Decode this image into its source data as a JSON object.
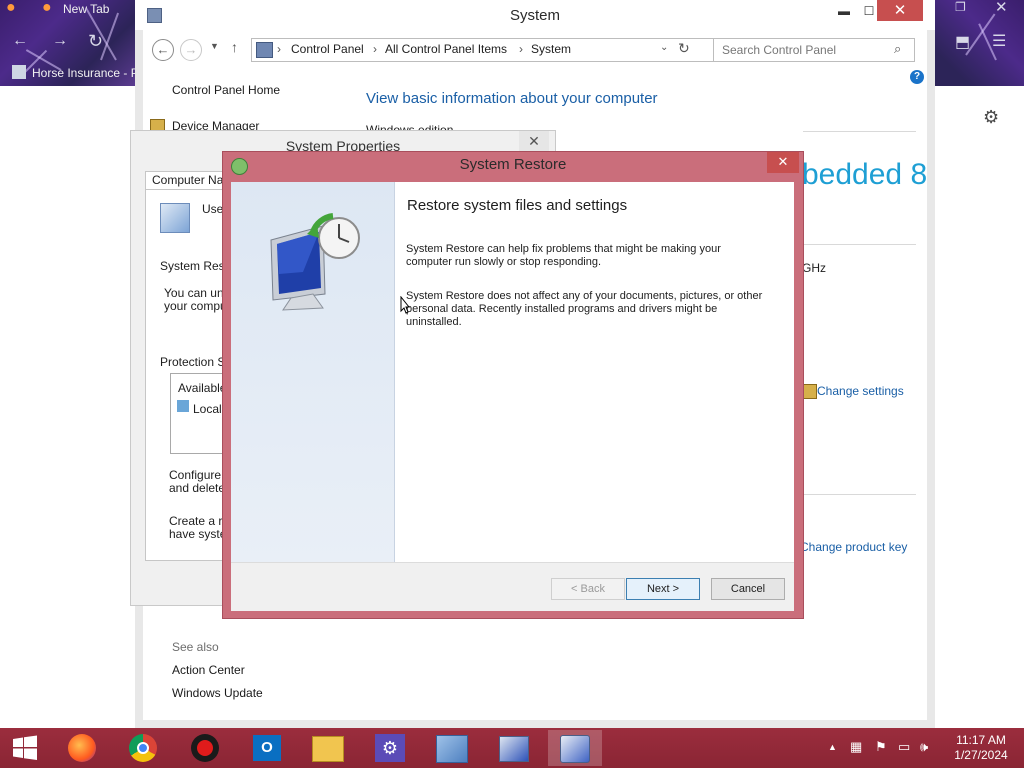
{
  "firefox": {
    "tabs": [
      {
        "label": "New Tab"
      }
    ],
    "bookmark": "Horse Insurance - P"
  },
  "control_panel": {
    "title": "System",
    "breadcrumb": [
      "Control Panel",
      "All Control Panel Items",
      "System"
    ],
    "search_placeholder": "Search Control Panel",
    "sidebar": {
      "home": "Control Panel Home",
      "items": [
        "Device Manager"
      ],
      "see_also_heading": "See also",
      "see_also": [
        "Action Center",
        "Windows Update"
      ]
    },
    "main": {
      "heading": "View basic information about your computer",
      "edition_label": "Windows edition",
      "edition_fragment": "bedded 8",
      "cpu_fragment": "GHz",
      "change_settings": "Change settings",
      "change_product_key": "Change product key"
    }
  },
  "system_properties": {
    "title": "System Properties",
    "tab": "Computer Nam",
    "use_text": "Use",
    "system_restore_label": "System Resto",
    "desc_line1": "You can und",
    "desc_line2": "your compute",
    "protection_label": "Protection Se",
    "list_header": "Available",
    "list_item": "Local",
    "configure_line1": "Configure re",
    "configure_line2": "and delete",
    "create_line1": "Create a re",
    "create_line2": "have syster"
  },
  "system_restore": {
    "title": "System Restore",
    "heading": "Restore system files and settings",
    "para1": "System Restore can help fix problems that might be making your computer run slowly or stop responding.",
    "para2": "System Restore does not affect any of your documents, pictures, or other personal data. Recently installed programs and drivers might be uninstalled.",
    "buttons": {
      "back": "< Back",
      "next": "Next >",
      "cancel": "Cancel"
    }
  },
  "taskbar": {
    "time": "11:17 AM",
    "date": "1/27/2024",
    "apps": [
      "start",
      "firefox",
      "chrome",
      "recorder",
      "outlook",
      "file-explorer",
      "settings",
      "control-panel",
      "system",
      "system-restore"
    ]
  },
  "colors": {
    "accent": "#1a5fa6",
    "title_teal": "#1e9fd4",
    "taskbar": "#9b2d3d",
    "dialog_border": "#ca6e7b",
    "close_red": "#c74f4f"
  }
}
